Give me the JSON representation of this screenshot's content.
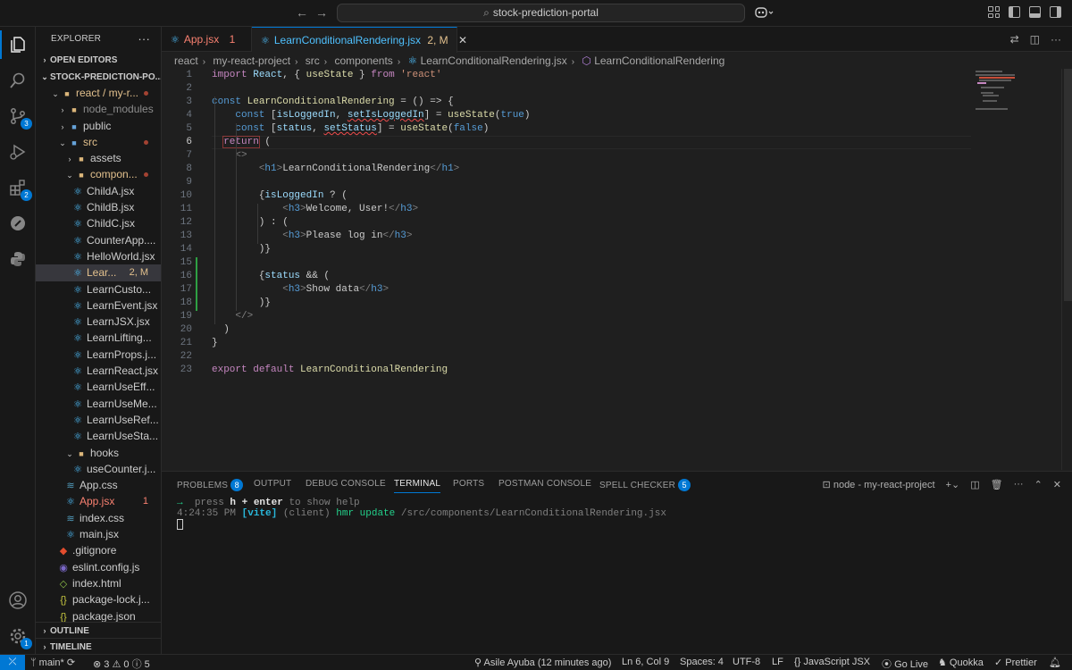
{
  "titlebar": {
    "search": "stock-prediction-portal",
    "back_icon": "arrow-left-icon",
    "forward_icon": "arrow-right-icon"
  },
  "activity": {
    "explorer": "files-icon",
    "search": "search-icon",
    "scm": "source-control-icon",
    "scm_badge": "3",
    "run": "run-debug-icon",
    "extensions": "extensions-icon",
    "extensions_badge": "2",
    "postman": "postman-icon",
    "python": "python-icon",
    "accounts": "account-icon",
    "settings": "gear-icon",
    "settings_badge": "1"
  },
  "explorer": {
    "title": "EXPLORER",
    "open_editors": "OPEN EDITORS",
    "project": "STOCK-PREDICTION-PO...",
    "rows": [
      {
        "label": "react / my-r...",
        "indent": 1,
        "kind": "folder-open",
        "color": "#e2c08d",
        "dot": true
      },
      {
        "label": "node_modules",
        "indent": 2,
        "kind": "folder",
        "color": "#8c8c8c"
      },
      {
        "label": "public",
        "indent": 2,
        "kind": "folder",
        "color": "#cccccc"
      },
      {
        "label": "src",
        "indent": 2,
        "kind": "folder-open",
        "color": "#e2c08d",
        "dot": true
      },
      {
        "label": "assets",
        "indent": 3,
        "kind": "folder",
        "color": "#cccccc"
      },
      {
        "label": "compon...",
        "indent": 3,
        "kind": "folder-open",
        "color": "#e2c08d",
        "dot": true
      },
      {
        "label": "ChildA.jsx",
        "indent": 4,
        "kind": "react",
        "color": "#cccccc"
      },
      {
        "label": "ChildB.jsx",
        "indent": 4,
        "kind": "react",
        "color": "#cccccc"
      },
      {
        "label": "ChildC.jsx",
        "indent": 4,
        "kind": "react",
        "color": "#cccccc"
      },
      {
        "label": "CounterApp....",
        "indent": 4,
        "kind": "react",
        "color": "#cccccc"
      },
      {
        "label": "HelloWorld.jsx",
        "indent": 4,
        "kind": "react",
        "color": "#cccccc"
      },
      {
        "label": "Lear...",
        "indent": 4,
        "kind": "react",
        "color": "#e2c08d",
        "suffix": "2, M",
        "selected": true
      },
      {
        "label": "LearnCusto...",
        "indent": 4,
        "kind": "react",
        "color": "#cccccc"
      },
      {
        "label": "LearnEvent.jsx",
        "indent": 4,
        "kind": "react",
        "color": "#cccccc"
      },
      {
        "label": "LearnJSX.jsx",
        "indent": 4,
        "kind": "react",
        "color": "#cccccc"
      },
      {
        "label": "LearnLifting...",
        "indent": 4,
        "kind": "react",
        "color": "#cccccc"
      },
      {
        "label": "LearnProps.j...",
        "indent": 4,
        "kind": "react",
        "color": "#cccccc"
      },
      {
        "label": "LearnReact.jsx",
        "indent": 4,
        "kind": "react",
        "color": "#cccccc"
      },
      {
        "label": "LearnUseEff...",
        "indent": 4,
        "kind": "react",
        "color": "#cccccc"
      },
      {
        "label": "LearnUseMe...",
        "indent": 4,
        "kind": "react",
        "color": "#cccccc"
      },
      {
        "label": "LearnUseRef...",
        "indent": 4,
        "kind": "react",
        "color": "#cccccc"
      },
      {
        "label": "LearnUseSta...",
        "indent": 4,
        "kind": "react",
        "color": "#cccccc"
      },
      {
        "label": "hooks",
        "indent": 3,
        "kind": "folder-open",
        "color": "#cccccc"
      },
      {
        "label": "useCounter.j...",
        "indent": 4,
        "kind": "react",
        "color": "#cccccc"
      },
      {
        "label": "App.css",
        "indent": 3,
        "kind": "css",
        "color": "#cccccc"
      },
      {
        "label": "App.jsx",
        "indent": 3,
        "kind": "react",
        "color": "#f88070",
        "suffix": "1"
      },
      {
        "label": "index.css",
        "indent": 3,
        "kind": "css",
        "color": "#cccccc"
      },
      {
        "label": "main.jsx",
        "indent": 3,
        "kind": "react",
        "color": "#cccccc"
      },
      {
        "label": ".gitignore",
        "indent": 2,
        "kind": "git",
        "color": "#cccccc"
      },
      {
        "label": "eslint.config.js",
        "indent": 2,
        "kind": "eslint",
        "color": "#cccccc"
      },
      {
        "label": "index.html",
        "indent": 2,
        "kind": "html",
        "color": "#cccccc"
      },
      {
        "label": "package-lock.j...",
        "indent": 2,
        "kind": "json",
        "color": "#cccccc"
      },
      {
        "label": "package.json",
        "indent": 2,
        "kind": "json",
        "color": "#cccccc"
      }
    ],
    "outline": "OUTLINE",
    "timeline": "TIMELINE"
  },
  "tabs": [
    {
      "label": "App.jsx",
      "suffix": "1"
    },
    {
      "label": "LearnConditionalRendering.jsx",
      "suffix": "2, M"
    }
  ],
  "breadcrumbs": [
    "react",
    "my-react-project",
    "src",
    "components",
    "LearnConditionalRendering.jsx",
    "LearnConditionalRendering"
  ],
  "editor": {
    "current_line": 6,
    "lines": [
      "import React, { useState } from 'react'",
      "",
      "const LearnConditionalRendering = () => {",
      "    const [isLoggedIn, setIsLoggedIn] = useState(true)",
      "    const [status, setStatus] = useState(false)",
      "  return (",
      "    <>",
      "        <h1>LearnConditionalRendering</h1>",
      "",
      "        {isLoggedIn ? (",
      "            <h3>Welcome, User!</h3>",
      "        ) : (",
      "            <h3>Please log in</h3>",
      "        )}",
      "",
      "        {status && (",
      "            <h3>Show data</h3>",
      "        )}",
      "    </>",
      "  )",
      "}",
      "",
      "export default LearnConditionalRendering"
    ]
  },
  "panel": {
    "tabs": [
      "PROBLEMS",
      "OUTPUT",
      "DEBUG CONSOLE",
      "TERMINAL",
      "PORTS",
      "POSTMAN CONSOLE",
      "SPELL CHECKER"
    ],
    "problems_badge": "8",
    "spell_badge": "5",
    "terminal_name": "node - my-react-project",
    "term_line1_prompt": "→",
    "term_line1_a": "press ",
    "term_line1_key": "h + enter",
    "term_line1_b": " to show help",
    "term_time": "4:24:35 PM",
    "term_vite": "[vite]",
    "term_client": "(client)",
    "term_hmr": "hmr update",
    "term_path": "/src/components/LearnConditionalRendering.jsx"
  },
  "status": {
    "branch": "main*",
    "errors": "3",
    "warnings": "0",
    "info": "5",
    "author": "Asile Ayuba (12 minutes ago)",
    "position": "Ln 6, Col 9",
    "spaces": "Spaces: 4",
    "encoding": "UTF-8",
    "eol": "LF",
    "language": "JavaScript JSX",
    "golive": "Go Live",
    "quokka": "Quokka",
    "prettier": "Prettier"
  },
  "colors": {
    "accent": "#0078d4",
    "modified": "#e2c08d",
    "error": "#f88070"
  }
}
